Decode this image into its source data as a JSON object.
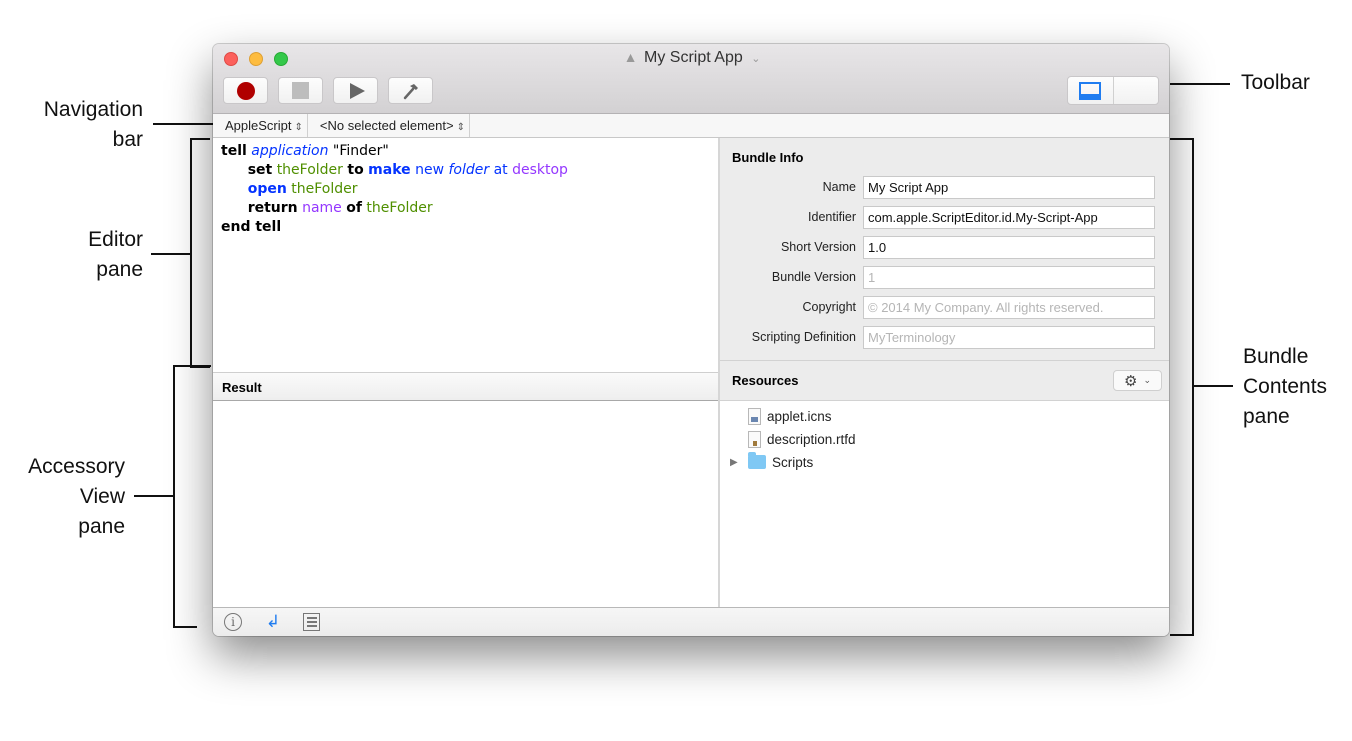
{
  "window": {
    "title": "My Script App",
    "title_icon": "script-app-icon",
    "traffic_lights": [
      "close",
      "minimize",
      "zoom"
    ]
  },
  "toolbar": {
    "buttons": [
      {
        "name": "record",
        "icon": "record-icon"
      },
      {
        "name": "stop",
        "icon": "stop-icon"
      },
      {
        "name": "run",
        "icon": "play-icon"
      },
      {
        "name": "compile",
        "icon": "hammer-icon"
      }
    ],
    "view_toggles": [
      {
        "name": "show-accessory-view",
        "icon": "bottom-pane-icon"
      },
      {
        "name": "show-bundle-contents",
        "icon": "right-pane-icon"
      }
    ]
  },
  "navbar": {
    "language": "AppleScript",
    "element": "<No selected element>"
  },
  "editor": {
    "lines": [
      [
        {
          "t": "tell",
          "c": "kw"
        },
        {
          "t": " "
        },
        {
          "t": "application",
          "c": "cls"
        },
        {
          "t": " \"Finder\""
        }
      ],
      [
        {
          "t": "      "
        },
        {
          "t": "set",
          "c": "kw"
        },
        {
          "t": " "
        },
        {
          "t": "theFolder",
          "c": "var"
        },
        {
          "t": " "
        },
        {
          "t": "to",
          "c": "kw"
        },
        {
          "t": " "
        },
        {
          "t": "make",
          "c": "kwb"
        },
        {
          "t": " "
        },
        {
          "t": "new",
          "c": "cmd"
        },
        {
          "t": " "
        },
        {
          "t": "folder",
          "c": "cls"
        },
        {
          "t": " "
        },
        {
          "t": "at",
          "c": "cmd"
        },
        {
          "t": " "
        },
        {
          "t": "desktop",
          "c": "prop"
        }
      ],
      [
        {
          "t": "      "
        },
        {
          "t": "open",
          "c": "kwb"
        },
        {
          "t": " "
        },
        {
          "t": "theFolder",
          "c": "var"
        }
      ],
      [
        {
          "t": "      "
        },
        {
          "t": "return",
          "c": "kw"
        },
        {
          "t": " "
        },
        {
          "t": "name",
          "c": "prop"
        },
        {
          "t": " "
        },
        {
          "t": "of",
          "c": "kw"
        },
        {
          "t": " "
        },
        {
          "t": "theFolder",
          "c": "var"
        }
      ],
      [
        {
          "t": "end tell",
          "c": "kw"
        }
      ]
    ]
  },
  "result": {
    "header": "Result",
    "content": ""
  },
  "bundle_info": {
    "header": "Bundle Info",
    "fields": [
      {
        "label": "Name",
        "value": "My Script App",
        "placeholder": false
      },
      {
        "label": "Identifier",
        "value": "com.apple.ScriptEditor.id.My-Script-App",
        "placeholder": false
      },
      {
        "label": "Short Version",
        "value": "1.0",
        "placeholder": false
      },
      {
        "label": "Bundle Version",
        "value": "1",
        "placeholder": true
      },
      {
        "label": "Copyright",
        "value": "© 2014 My Company. All rights reserved.",
        "placeholder": true
      },
      {
        "label": "Scripting Definition",
        "value": "MyTerminology",
        "placeholder": true
      }
    ]
  },
  "resources": {
    "header": "Resources",
    "action_icon": "gear-icon",
    "items": [
      {
        "name": "applet.icns",
        "type": "file-icns"
      },
      {
        "name": "description.rtfd",
        "type": "file-rtfd"
      },
      {
        "name": "Scripts",
        "type": "folder",
        "expandable": true
      }
    ]
  },
  "bottom_bar": {
    "icons": [
      "info-icon",
      "return-arrow-icon",
      "list-icon"
    ]
  },
  "callouts": {
    "navigation_bar": [
      "Navigation",
      "bar"
    ],
    "editor_pane": [
      "Editor",
      "pane"
    ],
    "accessory_view_pane": [
      "Accessory",
      "View",
      "pane"
    ],
    "toolbar": [
      "Toolbar"
    ],
    "bundle_contents_pane": [
      "Bundle",
      "Contents",
      "pane"
    ]
  }
}
